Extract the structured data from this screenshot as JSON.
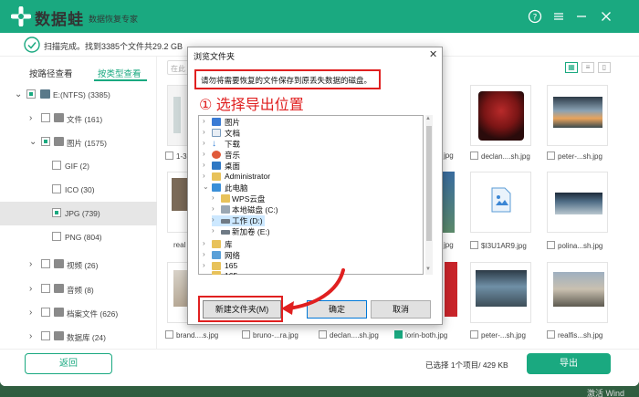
{
  "app": {
    "brand": "数据蛙",
    "subtitle": "数据恢复专家",
    "status": "扫描完成。找到3385个文件共29.2 GB",
    "accent": "#1aa980"
  },
  "tabs": [
    "按路径查看",
    "按类型查看"
  ],
  "search_placeholder": "在此",
  "tree": [
    {
      "label": "E:(NTFS) (3385)",
      "icon": "drive-icon"
    },
    {
      "label": "文件 (161)",
      "icon": "doc-icon"
    },
    {
      "label": "图片 (1575)",
      "icon": "image-icon"
    },
    {
      "label": "GIF (2)"
    },
    {
      "label": "ICO (30)"
    },
    {
      "label": "JPG (739)"
    },
    {
      "label": "PNG (804)"
    },
    {
      "label": "视频 (26)",
      "icon": "video-icon"
    },
    {
      "label": "音频 (8)",
      "icon": "audio-icon"
    },
    {
      "label": "档案文件 (626)",
      "icon": "archive-icon"
    },
    {
      "label": "数据库 (24)",
      "icon": "database-icon"
    }
  ],
  "thumbs": {
    "row1": [
      "1-3",
      "jpg",
      "declan....sh.jpg",
      "peter-...sh.jpg"
    ],
    "row2": [
      "real",
      "jpg",
      "$I3U1AR9.jpg",
      "polina...sh.jpg"
    ],
    "row3": [
      "brand....s.jpg",
      "bruno-...ra.jpg",
      "declan....sh.jpg",
      "lorin-both.jpg",
      "peter-...sh.jpg",
      "realfis...sh.jpg"
    ]
  },
  "bottom": {
    "back": "返回",
    "selected": "已选择 1个项目/ 429 KB",
    "export": "导出",
    "watermark": "激活 Wind"
  },
  "dialog": {
    "title": "浏览文件夹",
    "description": "请勿将需要恢复的文件保存到原丢失数据的磁盘。",
    "annotation": "① 选择导出位置",
    "folders": [
      {
        "label": "图片",
        "icon": "pictures-icon"
      },
      {
        "label": "文档",
        "icon": "documents-icon"
      },
      {
        "label": "下载",
        "icon": "download-icon"
      },
      {
        "label": "音乐",
        "icon": "music-icon"
      },
      {
        "label": "桌面",
        "icon": "desktop-icon"
      },
      {
        "label": "Administrator",
        "icon": "folder-icon"
      },
      {
        "label": "此电脑",
        "icon": "computer-icon"
      },
      {
        "label": "WPS云盘",
        "icon": "cloud-folder-icon"
      },
      {
        "label": "本地磁盘 (C:)",
        "icon": "disk-icon"
      },
      {
        "label": "工作 (D:)",
        "icon": "disk-icon"
      },
      {
        "label": "新加卷 (E:)",
        "icon": "disk-icon"
      },
      {
        "label": "库",
        "icon": "library-icon"
      },
      {
        "label": "网络",
        "icon": "network-icon"
      },
      {
        "label": "165",
        "icon": "folder-icon"
      },
      {
        "label": "165",
        "icon": "folder-icon"
      }
    ],
    "new_folder": "新建文件夹(M)",
    "ok": "确定",
    "cancel": "取消"
  }
}
